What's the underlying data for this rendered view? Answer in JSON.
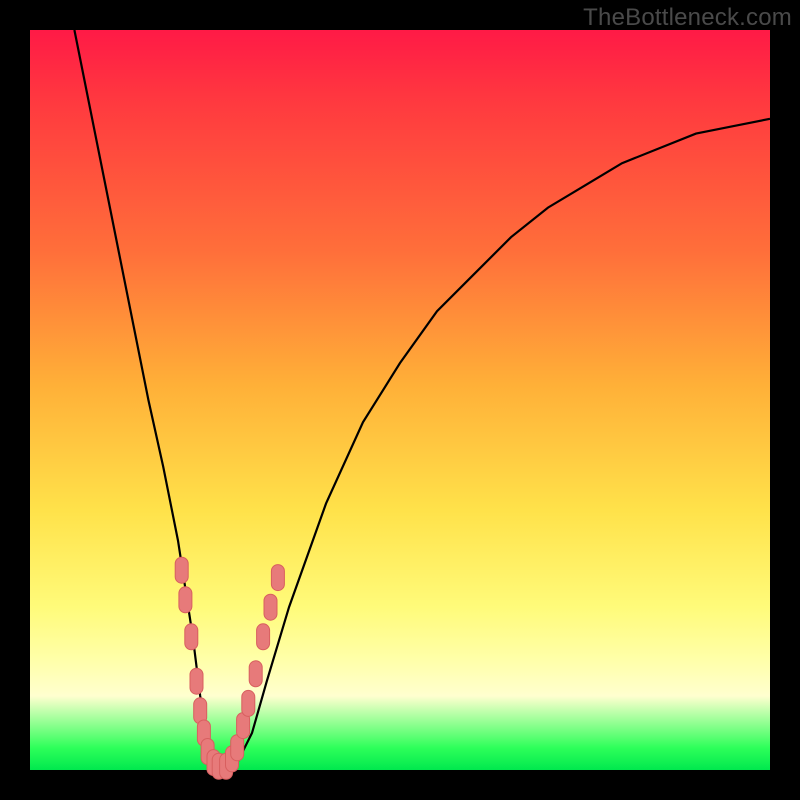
{
  "watermark": "TheBottleneck.com",
  "colors": {
    "frame": "#000000",
    "curve": "#000000",
    "marker_fill": "#e77a7a",
    "marker_stroke": "#d85f5f",
    "gradient": [
      "#ff1a46",
      "#ff3a3f",
      "#ff6f3a",
      "#ffb038",
      "#ffe24a",
      "#fffb7a",
      "#ffffa8",
      "#ffffcf",
      "#2eff5a",
      "#00e84e"
    ]
  },
  "chart_data": {
    "type": "line",
    "title": "",
    "xlabel": "",
    "ylabel": "",
    "xlim": [
      0,
      100
    ],
    "ylim": [
      0,
      100
    ],
    "grid": false,
    "series": [
      {
        "name": "bottleneck-curve",
        "x": [
          6,
          8,
          10,
          12,
          14,
          16,
          18,
          20,
          22,
          23,
          24,
          25,
          26,
          27,
          28,
          30,
          32,
          35,
          40,
          45,
          50,
          55,
          60,
          65,
          70,
          75,
          80,
          85,
          90,
          95,
          100
        ],
        "y": [
          100,
          90,
          80,
          70,
          60,
          50,
          41,
          31,
          18,
          10,
          4,
          1,
          0,
          0,
          1,
          5,
          12,
          22,
          36,
          47,
          55,
          62,
          67,
          72,
          76,
          79,
          82,
          84,
          86,
          87,
          88
        ]
      }
    ],
    "markers": {
      "name": "highlighted-points",
      "comment": "salmon capsule markers clustered around the V minimum on both branches",
      "points": [
        {
          "x": 20.5,
          "y": 27
        },
        {
          "x": 21.0,
          "y": 23
        },
        {
          "x": 21.8,
          "y": 18
        },
        {
          "x": 22.5,
          "y": 12
        },
        {
          "x": 23.0,
          "y": 8
        },
        {
          "x": 23.5,
          "y": 5
        },
        {
          "x": 24.0,
          "y": 2.5
        },
        {
          "x": 24.8,
          "y": 1
        },
        {
          "x": 25.5,
          "y": 0.5
        },
        {
          "x": 26.5,
          "y": 0.5
        },
        {
          "x": 27.3,
          "y": 1.5
        },
        {
          "x": 28.0,
          "y": 3
        },
        {
          "x": 28.8,
          "y": 6
        },
        {
          "x": 29.5,
          "y": 9
        },
        {
          "x": 30.5,
          "y": 13
        },
        {
          "x": 31.5,
          "y": 18
        },
        {
          "x": 32.5,
          "y": 22
        },
        {
          "x": 33.5,
          "y": 26
        }
      ]
    }
  }
}
